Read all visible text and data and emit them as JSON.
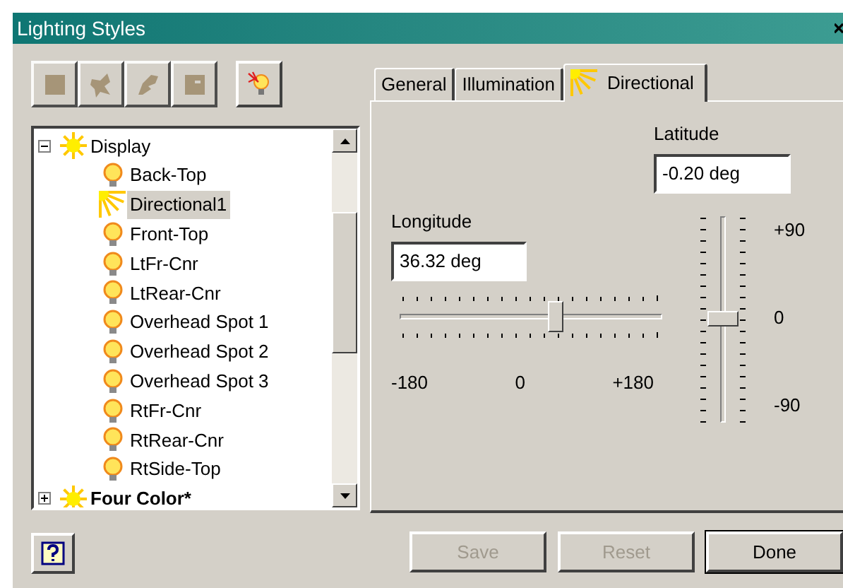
{
  "window": {
    "title": "Lighting Styles"
  },
  "toolbar": [
    {
      "kind": "square",
      "disabled": true
    },
    {
      "kind": "splat",
      "disabled": true
    },
    {
      "kind": "leaf",
      "disabled": true
    },
    {
      "kind": "box",
      "disabled": true
    },
    {
      "kind": "bulb",
      "disabled": false
    }
  ],
  "tree": [
    {
      "label": "Display",
      "kind": "sun",
      "expanded": true,
      "selected": false,
      "active": false,
      "children": [
        {
          "label": "Back-Top",
          "kind": "bulb",
          "selected": false
        },
        {
          "label": "Directional1",
          "kind": "directional",
          "selected": true
        },
        {
          "label": "Front-Top",
          "kind": "bulb",
          "selected": false
        },
        {
          "label": "LtFr-Cnr",
          "kind": "bulb",
          "selected": false
        },
        {
          "label": "LtRear-Cnr",
          "kind": "bulb",
          "selected": false
        },
        {
          "label": "Overhead Spot 1",
          "kind": "bulb",
          "selected": false
        },
        {
          "label": "Overhead Spot 2",
          "kind": "bulb",
          "selected": false
        },
        {
          "label": "Overhead Spot 3",
          "kind": "bulb",
          "selected": false
        },
        {
          "label": "RtFr-Cnr",
          "kind": "bulb",
          "selected": false
        },
        {
          "label": "RtRear-Cnr",
          "kind": "bulb",
          "selected": false
        },
        {
          "label": "RtSide-Top",
          "kind": "bulb",
          "selected": false
        }
      ]
    },
    {
      "label": "Four Color*",
      "kind": "sun",
      "expanded": false,
      "selected": false,
      "active": true
    }
  ],
  "tabs": [
    {
      "label": "General",
      "selected": false,
      "kind": "plain"
    },
    {
      "label": "Illumination",
      "selected": false,
      "kind": "plain"
    },
    {
      "label": "Directional",
      "selected": true,
      "kind": "directional"
    }
  ],
  "latitude": {
    "label": "Latitude",
    "value": "-0.20 deg",
    "level": 0.499,
    "ticks": [
      "+90",
      "0",
      "-90"
    ]
  },
  "longitude": {
    "label": "Longitude",
    "value": "36.32 deg",
    "level": 0.601,
    "ticks": [
      "-180",
      "0",
      "+180"
    ]
  },
  "buttons": [
    {
      "label": "Save",
      "disabled": true,
      "default": false
    },
    {
      "label": "Reset",
      "disabled": true,
      "default": false
    },
    {
      "label": "Done",
      "disabled": false,
      "default": true
    }
  ]
}
